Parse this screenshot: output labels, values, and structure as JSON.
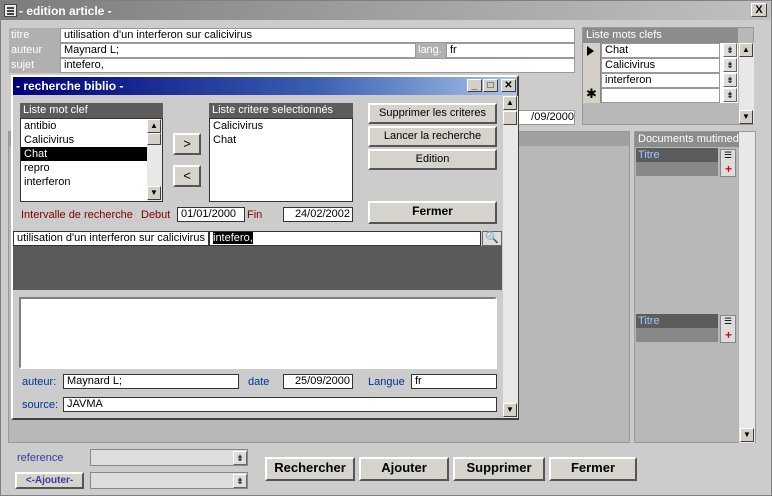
{
  "window": {
    "title": "- edition article -",
    "close": "X"
  },
  "article": {
    "rows": [
      {
        "label": "titre",
        "value": "utilisation d'un interferon sur calicivirus"
      },
      {
        "label": "auteur",
        "value": "Maynard L;"
      },
      {
        "label": "sujet",
        "value": "intefero,"
      }
    ],
    "lang_label": "lang.",
    "lang_value": "fr",
    "date_value": "/09/2000"
  },
  "keywords_panel": {
    "title": "Liste mots clefs",
    "items": [
      "Chat",
      "Calicivirus",
      "interferon",
      ""
    ]
  },
  "media_panel": {
    "title": "Documents mutimedia",
    "col1": "Titre",
    "col2": "Titre"
  },
  "dialog": {
    "title": "- recherche biblio -",
    "kw_list_title": "Liste mot clef",
    "kw_list": [
      "antibio",
      "Calicivirus",
      "Chat",
      "repro",
      "interferon"
    ],
    "selected_title": "Liste critere selectionnés",
    "selected": [
      "Calicivirus",
      "Chat"
    ],
    "btn_add": ">",
    "btn_remove": "<",
    "btn_delete": "Supprimer les criteres",
    "btn_search": "Lancer la recherche",
    "btn_edit": "Edition",
    "btn_close": "Fermer",
    "interval_label": "Intervalle de recherche",
    "debut_label": "Debut",
    "debut_value": "01/01/2000",
    "fin_label": "Fin",
    "fin_value": "24/02/2002",
    "result_title": "utilisation d'un interferon sur calicivirus",
    "result_subject": "intefero,",
    "auteur_label": "auteur:",
    "auteur_value": "Maynard L;",
    "date_label": "date",
    "date_value": "25/09/2000",
    "langue_label": "Langue",
    "langue_value": "fr",
    "source_label": "source:",
    "source_value": "JAVMA"
  },
  "footer": {
    "reference_label": "reference",
    "ajouter_small": "<-Ajouter-",
    "btn_rechercher": "Rechercher",
    "btn_ajouter": "Ajouter",
    "btn_supprimer": "Supprimer",
    "btn_fermer": "Fermer"
  }
}
